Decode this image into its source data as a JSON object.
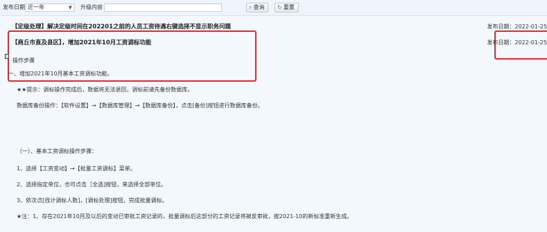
{
  "toolbar": {
    "date_label": "发布日期",
    "date_select": "近一年",
    "content_label": "升级内容",
    "content_value": "",
    "query_label": "查询",
    "reset_label": "重置"
  },
  "notice_1": {
    "title": "【定级处理】解决定级时间在202201之前的人员工资待遇右键选择不显示职务问题",
    "date": "发布日期：2022-01-25"
  },
  "notice_2": {
    "title": "【商丘市直及县区】，增加2021年10月工资调标功能",
    "date": "发布日期：2022-01-25",
    "steps_heading": "操作步骤",
    "step_1": "一、增加2021年10月基本工资调标功能。",
    "tip": "★★提示：调标操作完成后，数据将无法退回，调标前请先备份数据库。",
    "backup": "数据库备份操作：【软件设置】→【数据库管理】→【数据库备份】，点击[备份]按钮进行数据库备份。",
    "section_1": "（一）、基本工资调标操作步骤：",
    "op_1": "1、选择【工资变动】→【批量工资调标】菜单。",
    "op_2": "2、选择指定单位，也可点击［全选]按钮，来选择全部单位。",
    "op_3": "3、依次点[找计调标人数]，[调标处理]按钮，完成批量调标。",
    "note": "★注：1、存在2021年10月及以后的变动已审批工资记录的，批量调标后这部分的工资记录将被反审批，按2021-10的新标准重新生成。"
  },
  "colors": {
    "highlight_box": "#e0292c",
    "background": "#f3f8fd"
  }
}
